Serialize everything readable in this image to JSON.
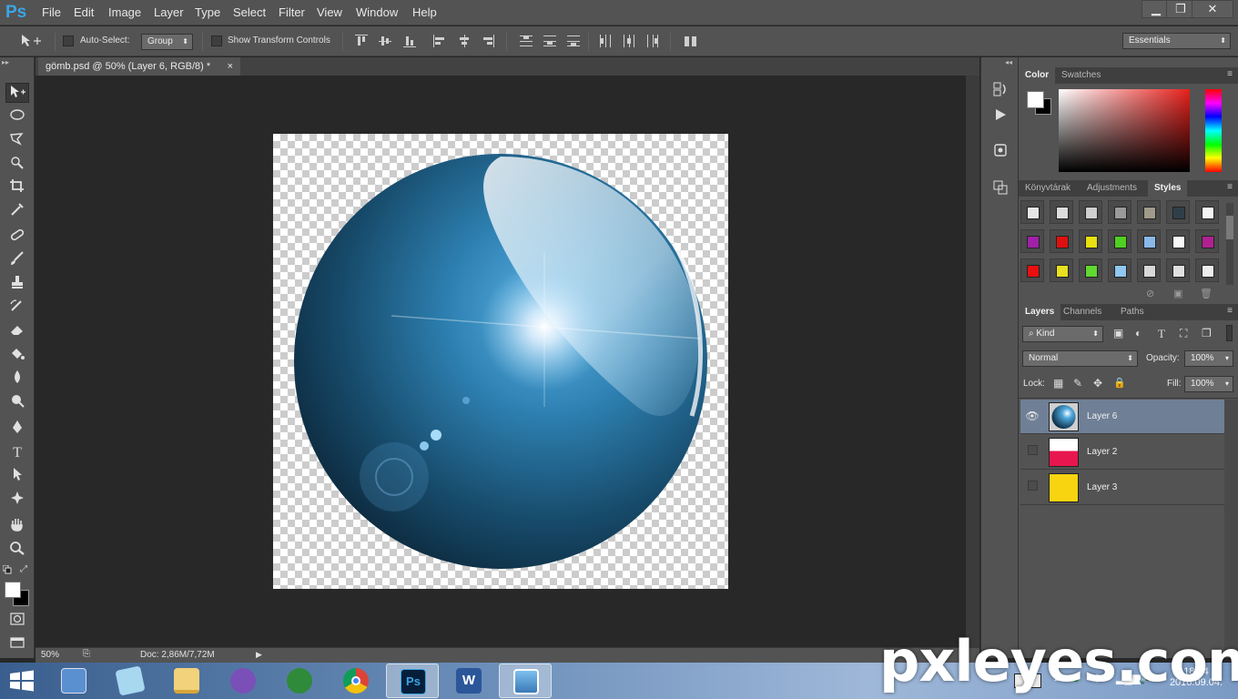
{
  "app": {
    "logo": "Ps"
  },
  "menu": [
    "File",
    "Edit",
    "Image",
    "Layer",
    "Type",
    "Select",
    "Filter",
    "View",
    "Window",
    "Help"
  ],
  "window_controls": {
    "minimize": "▁",
    "restore": "❐",
    "close": "✕"
  },
  "options": {
    "auto_select_label": "Auto-Select:",
    "auto_select_value": "Group",
    "transform_controls_label": "Show Transform Controls",
    "workspace": "Essentials"
  },
  "document": {
    "tab_title": "gömb.psd @ 50% (Layer 6, RGB/8) *",
    "tab_close": "×",
    "zoom": "50%",
    "doc_size": "Doc: 2,86M/7,72M"
  },
  "color_panel": {
    "tabs": [
      "Color",
      "Swatches"
    ],
    "foreground": "#ffffff",
    "background": "#000000"
  },
  "styles_panel": {
    "tabs": [
      "Könyvtárak",
      "Adjustments",
      "Styles"
    ],
    "swatches": [
      [
        "#e6e6e6",
        "#dcdcdc",
        "#cfcfcf",
        "#9a9a9a",
        "#a09a8a",
        "#2f3f4a",
        "#f4f4f4"
      ],
      [
        "#a020a8",
        "#e01010",
        "#e8e010",
        "#50d020",
        "#8ab8e8",
        "#f8f8f8",
        "#b02090"
      ],
      [
        "#e81010",
        "#e8e020",
        "#60d830",
        "#90c8f0",
        "#d8d8d8",
        "#e0e0e0",
        "#ececec"
      ]
    ]
  },
  "layers_panel": {
    "tabs": [
      "Layers",
      "Channels",
      "Paths"
    ],
    "filter": "Kind",
    "blend_mode": "Normal",
    "opacity_label": "Opacity:",
    "opacity_value": "100%",
    "lock_label": "Lock:",
    "fill_label": "Fill:",
    "fill_value": "100%",
    "layers": [
      {
        "name": "Layer 6",
        "visible": true,
        "selected": true,
        "thumb": "sphere"
      },
      {
        "name": "Layer 2",
        "visible": false,
        "selected": false,
        "thumb": "#e8164e"
      },
      {
        "name": "Layer 3",
        "visible": false,
        "selected": false,
        "thumb": "#f8d410"
      }
    ]
  },
  "taskbar": {
    "clock_time": "18:34",
    "clock_date": "2016.09.04."
  },
  "watermark": "pxleyes.com"
}
